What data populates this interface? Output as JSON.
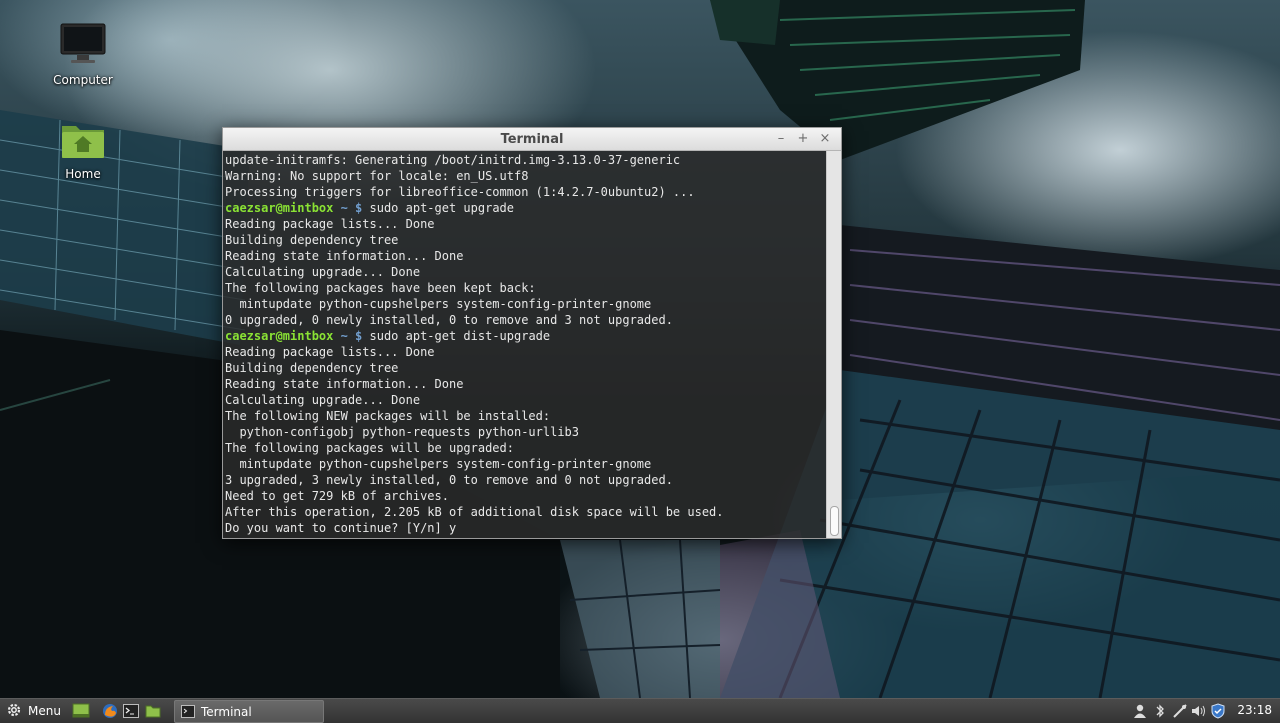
{
  "desktop": {
    "icons": [
      {
        "label": "Computer"
      },
      {
        "label": "Home"
      }
    ]
  },
  "window": {
    "title": "Terminal",
    "controls": {
      "minimize": "–",
      "maximize": "+",
      "close": "×"
    }
  },
  "terminal": {
    "prompt_user": "caezsar@mintbox",
    "prompt_path": "~ $",
    "lines": [
      {
        "t": "update-initramfs: Generating /boot/initrd.img-3.13.0-37-generic"
      },
      {
        "t": "Warning: No support for locale: en_US.utf8"
      },
      {
        "t": "Processing triggers for libreoffice-common (1:4.2.7-0ubuntu2) ..."
      },
      {
        "prompt": true,
        "cmd": "sudo apt-get upgrade"
      },
      {
        "t": "Reading package lists... Done"
      },
      {
        "t": "Building dependency tree"
      },
      {
        "t": "Reading state information... Done"
      },
      {
        "t": "Calculating upgrade... Done"
      },
      {
        "t": "The following packages have been kept back:"
      },
      {
        "t": "  mintupdate python-cupshelpers system-config-printer-gnome"
      },
      {
        "t": "0 upgraded, 0 newly installed, 0 to remove and 3 not upgraded."
      },
      {
        "prompt": true,
        "cmd": "sudo apt-get dist-upgrade"
      },
      {
        "t": "Reading package lists... Done"
      },
      {
        "t": "Building dependency tree"
      },
      {
        "t": "Reading state information... Done"
      },
      {
        "t": "Calculating upgrade... Done"
      },
      {
        "t": "The following NEW packages will be installed:"
      },
      {
        "t": "  python-configobj python-requests python-urllib3"
      },
      {
        "t": "The following packages will be upgraded:"
      },
      {
        "t": "  mintupdate python-cupshelpers system-config-printer-gnome"
      },
      {
        "t": "3 upgraded, 3 newly installed, 0 to remove and 0 not upgraded."
      },
      {
        "t": "Need to get 729 kB of archives."
      },
      {
        "t": "After this operation, 2.205 kB of additional disk space will be used."
      },
      {
        "t": "Do you want to continue? [Y/n] y"
      }
    ],
    "colors": {
      "user": "#8ae234",
      "path": "#729fcf",
      "text": "#e8e8e8",
      "bg": "#2b2b2b"
    }
  },
  "panel": {
    "menu_label": "Menu",
    "launchers": [
      "show-desktop-icon",
      "firefox-icon",
      "terminal-icon",
      "files-icon"
    ],
    "tasks": [
      {
        "label": "Terminal"
      }
    ],
    "tray": [
      "user-icon",
      "bluetooth-icon",
      "volume-icon",
      "network-icon",
      "update-shield-icon"
    ],
    "clock": "23:18"
  }
}
